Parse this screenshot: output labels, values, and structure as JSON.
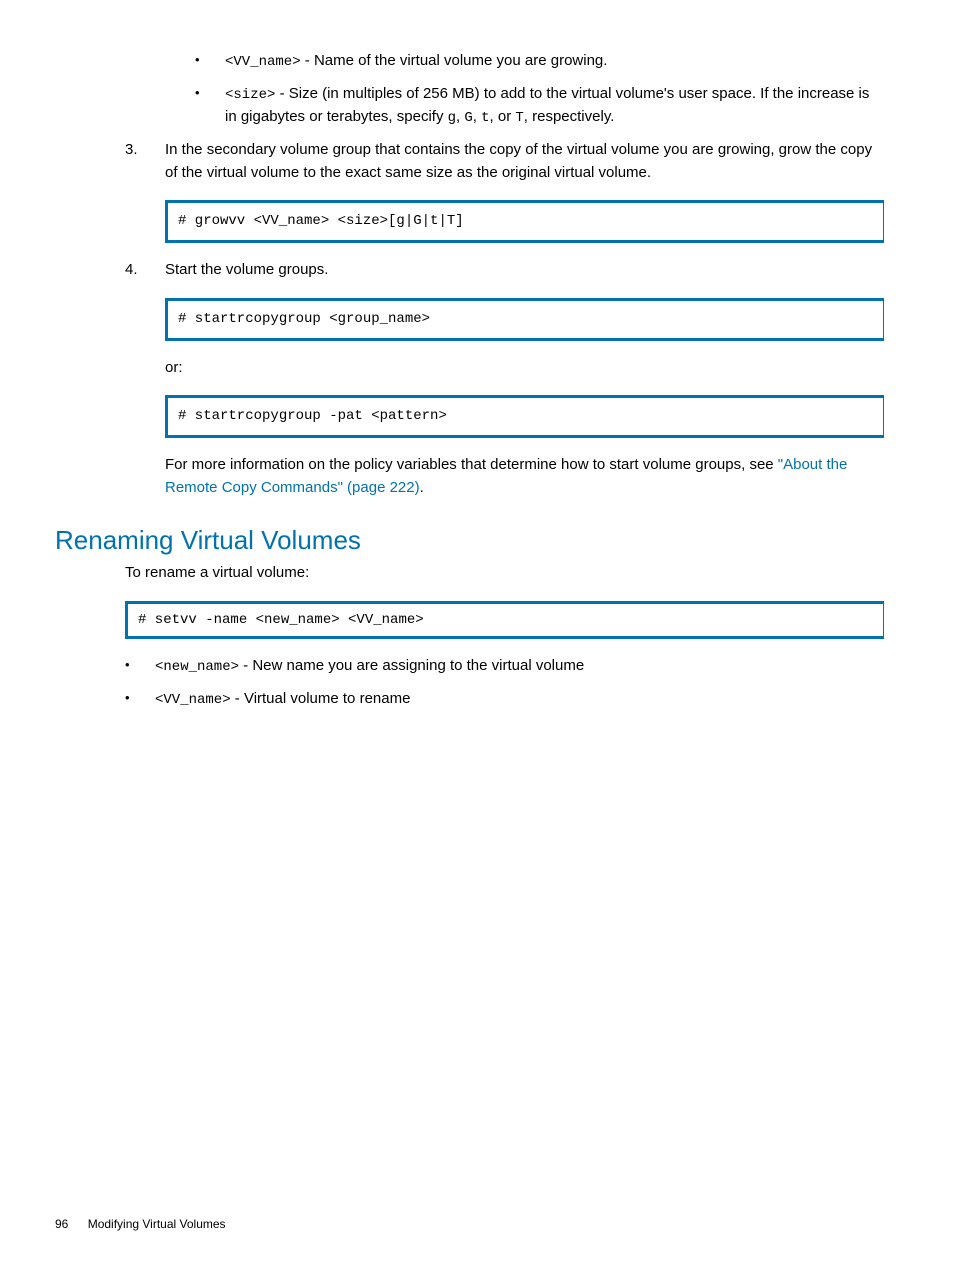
{
  "bullets1": {
    "item1_code": "<VV_name>",
    "item1_text": " - Name of the virtual volume you are growing.",
    "item2_code": "<size>",
    "item2_text_a": " - Size (in multiples of 256 MB) to add to the virtual volume's user space. If the increase is in gigabytes or terabytes, specify ",
    "item2_g": "g",
    "item2_sep1": ", ",
    "item2_G": "G",
    "item2_sep2": ", ",
    "item2_t": "t",
    "item2_sep3": ", or ",
    "item2_T": "T",
    "item2_text_b": ", respectively."
  },
  "step3": {
    "num": "3.",
    "text": "In the secondary volume group that contains the copy of the virtual volume you are growing, grow the copy of the virtual volume to the exact same size as the original virtual volume.",
    "code": "# growvv <VV_name> <size>[g|G|t|T]"
  },
  "step4": {
    "num": "4.",
    "text": "Start the volume groups.",
    "code1": "# startrcopygroup <group_name>",
    "or": "or:",
    "code2": "# startrcopygroup -pat <pattern>",
    "info_a": "For more information on the policy variables that determine how to start volume groups, see ",
    "link": "\"About the Remote Copy Commands\" (page 222)",
    "info_b": "."
  },
  "section2": {
    "heading": "Renaming Virtual Volumes",
    "intro": "To rename a virtual volume:",
    "code": "# setvv -name <new_name> <VV_name>",
    "bullet1_code": "<new_name>",
    "bullet1_text": " - New name you are assigning to the virtual volume",
    "bullet2_code": "<VV_name>",
    "bullet2_text": " - Virtual volume to rename"
  },
  "footer": {
    "page": "96",
    "title": "Modifying Virtual Volumes"
  }
}
